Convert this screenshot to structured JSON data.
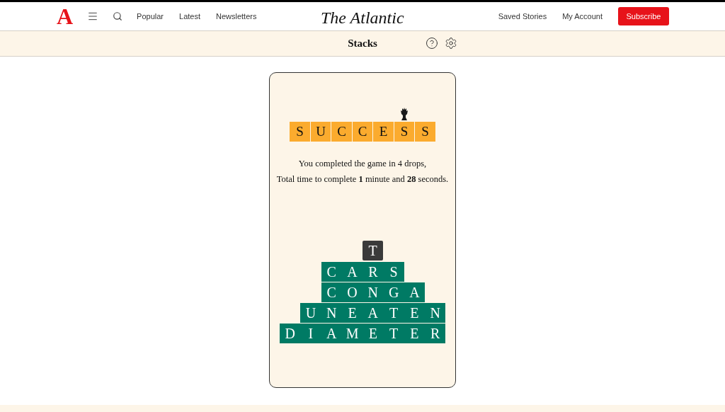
{
  "header": {
    "logo": "A",
    "nav": [
      "Popular",
      "Latest",
      "Newsletters"
    ],
    "masthead": "The Atlantic",
    "links": [
      "Saved Stories",
      "My Account"
    ],
    "subscribe": "Subscribe"
  },
  "subheader": {
    "title": "Stacks"
  },
  "result": {
    "tiles": [
      {
        "letter": "S",
        "crowned": false
      },
      {
        "letter": "U",
        "crowned": false
      },
      {
        "letter": "C",
        "crowned": false
      },
      {
        "letter": "C",
        "crowned": false
      },
      {
        "letter": "E",
        "crowned": false
      },
      {
        "letter": "S",
        "crowned": true
      },
      {
        "letter": "S",
        "crowned": false
      }
    ],
    "lines": [
      "You completed the game in 4 drops,",
      "Total time to complete **1** minute and **28** seconds."
    ]
  },
  "stack": {
    "pending": {
      "cells": [
        {
          "kind": "gap"
        },
        {
          "kind": "gap"
        },
        {
          "kind": "gap"
        },
        {
          "kind": "gap"
        },
        {
          "kind": "letter",
          "letter": "T"
        }
      ]
    },
    "rows": [
      {
        "cells": [
          {
            "kind": "gap"
          },
          {
            "kind": "gap"
          },
          {
            "kind": "letter",
            "letter": "C"
          },
          {
            "kind": "letter",
            "letter": "A"
          },
          {
            "kind": "letter",
            "letter": "R"
          },
          {
            "kind": "letter",
            "letter": "S"
          }
        ]
      },
      {
        "cells": [
          {
            "kind": "gap"
          },
          {
            "kind": "gap"
          },
          {
            "kind": "letter",
            "letter": "C"
          },
          {
            "kind": "letter",
            "letter": "O"
          },
          {
            "kind": "letter",
            "letter": "N"
          },
          {
            "kind": "letter",
            "letter": "G"
          },
          {
            "kind": "letter",
            "letter": "A"
          }
        ]
      },
      {
        "cells": [
          {
            "kind": "gap"
          },
          {
            "kind": "letter",
            "letter": "U"
          },
          {
            "kind": "letter",
            "letter": "N"
          },
          {
            "kind": "letter",
            "letter": "E"
          },
          {
            "kind": "letter",
            "letter": "A"
          },
          {
            "kind": "letter",
            "letter": "T"
          },
          {
            "kind": "letter",
            "letter": "E"
          },
          {
            "kind": "letter",
            "letter": "N"
          }
        ]
      },
      {
        "cells": [
          {
            "kind": "letter",
            "letter": "D"
          },
          {
            "kind": "letter",
            "letter": "I"
          },
          {
            "kind": "letter",
            "letter": "A"
          },
          {
            "kind": "letter",
            "letter": "M"
          },
          {
            "kind": "letter",
            "letter": "E"
          },
          {
            "kind": "letter",
            "letter": "T"
          },
          {
            "kind": "letter",
            "letter": "E"
          },
          {
            "kind": "letter",
            "letter": "R"
          }
        ]
      }
    ]
  }
}
